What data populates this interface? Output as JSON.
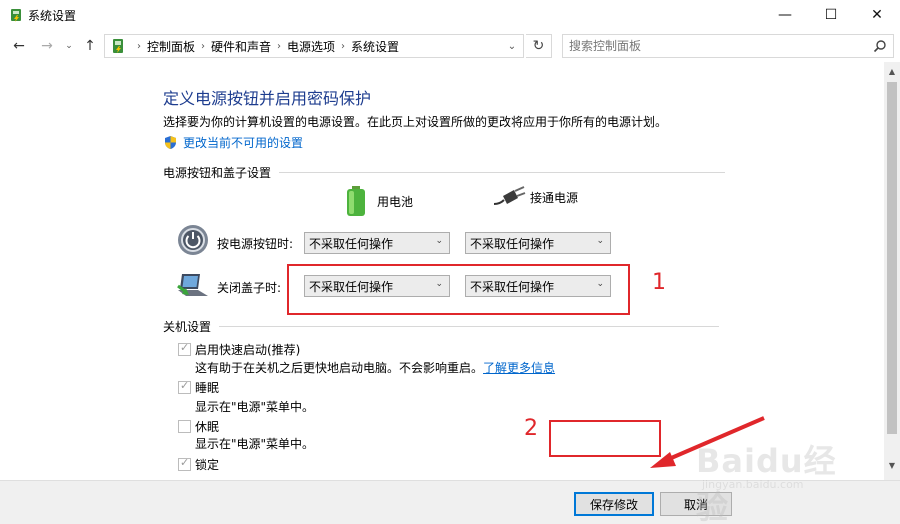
{
  "window": {
    "title": "系统设置",
    "minimize": "—",
    "maximize": "☐",
    "close": "✕"
  },
  "nav": {
    "back": "←",
    "forward": "→",
    "recent": "⌄",
    "up": "↑",
    "breadcrumbs": [
      "控制面板",
      "硬件和声音",
      "电源选项",
      "系统设置"
    ],
    "breadcrumb_sep": "›",
    "dropdown": "⌄",
    "refresh": "↻",
    "search_placeholder": "搜索控制面板"
  },
  "page": {
    "title": "定义电源按钮并启用密码保护",
    "description": "选择要为你的计算机设置的电源设置。在此页上对设置所做的更改将应用于你所有的电源计划。",
    "change_link": "更改当前不可用的设置"
  },
  "power_section": {
    "heading": "电源按钮和盖子设置",
    "col_battery": "用电池",
    "col_plugged": "接通电源",
    "rows": [
      {
        "label": "按电源按钮时:",
        "battery": "不采取任何操作",
        "plugged": "不采取任何操作"
      },
      {
        "label": "关闭盖子时:",
        "battery": "不采取任何操作",
        "plugged": "不采取任何操作"
      }
    ],
    "chevron": "⌄"
  },
  "shutdown_section": {
    "heading": "关机设置",
    "options": [
      {
        "label": "启用快速启动(推荐)",
        "checked": true,
        "desc": "这有助于在关机之后更快地启动电脑。不会影响重启。",
        "link": "了解更多信息"
      },
      {
        "label": "睡眠",
        "checked": true,
        "desc": "显示在\"电源\"菜单中。"
      },
      {
        "label": "休眠",
        "checked": false,
        "desc": "显示在\"电源\"菜单中。"
      },
      {
        "label": "锁定",
        "checked": true
      }
    ]
  },
  "annotations": {
    "marker_1": "1",
    "marker_2": "2",
    "color": "#e0272b"
  },
  "footer": {
    "save": "保存修改",
    "cancel": "取消"
  },
  "watermark": {
    "text": "Baidu经验",
    "sub": "jingyan.baidu.com"
  },
  "scrollbar": {
    "up": "▲",
    "down": "▼"
  }
}
